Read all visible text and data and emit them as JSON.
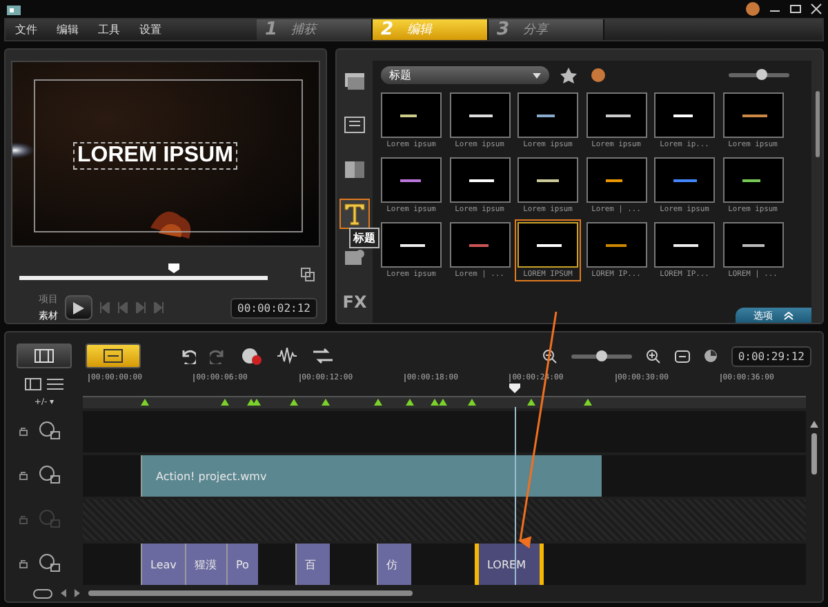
{
  "menu": [
    "文件",
    "编辑",
    "工具",
    "设置"
  ],
  "steps": [
    {
      "number": "1",
      "label": "捕获",
      "selected": false
    },
    {
      "number": "2",
      "label": "编辑",
      "selected": true
    },
    {
      "number": "3",
      "label": "分享",
      "selected": false
    }
  ],
  "preview": {
    "overlay_text": "LOREM IPSUM",
    "scrubber": {
      "level": 0.6
    },
    "modes": [
      {
        "label": "项目",
        "selected": false
      },
      {
        "label": "素材",
        "selected": true
      }
    ],
    "timecode": "00:00:02:12"
  },
  "library": {
    "categories": [
      {
        "kind": "media",
        "selected": false
      },
      {
        "kind": "instant",
        "selected": false
      },
      {
        "kind": "transition",
        "selected": false
      },
      {
        "kind": "title",
        "selected": true,
        "tooltip": "标题"
      },
      {
        "kind": "graphic",
        "selected": false
      },
      {
        "kind": "filter",
        "text": "FX",
        "selected": false
      }
    ],
    "dropdown": "标题",
    "size_slider": {
      "level": 0.55
    },
    "thumbnails": [
      {
        "label": "Lorem ipsum",
        "selected": false
      },
      {
        "label": "Lorem ipsum",
        "selected": false
      },
      {
        "label": "Lorem ipsum",
        "selected": false
      },
      {
        "label": "Lorem ipsum",
        "selected": false
      },
      {
        "label": "Lorem ip...",
        "selected": false
      },
      {
        "label": "Lorem ipsum",
        "selected": false
      },
      {
        "label": "Lorem ipsum",
        "selected": false
      },
      {
        "label": "Lorem ipsum",
        "selected": false
      },
      {
        "label": "Lorem ipsum",
        "selected": false
      },
      {
        "label": "Lorem | ...",
        "selected": false
      },
      {
        "label": "Lorem ipsum",
        "selected": false
      },
      {
        "label": "Lorem ipsum",
        "selected": false
      },
      {
        "label": "Lorem ipsum",
        "selected": false
      },
      {
        "label": "Lorem | ...",
        "selected": false
      },
      {
        "label": "LOREM IPSUM",
        "selected": true
      },
      {
        "label": "LOREM IP...",
        "selected": false
      },
      {
        "label": "LOREM IP...",
        "selected": false
      },
      {
        "label": "LOREM | ...",
        "selected": false
      }
    ],
    "options_button": "选项"
  },
  "timeline": {
    "views": [
      {
        "kind": "storyboard",
        "selected": false
      },
      {
        "kind": "timeline",
        "selected": true
      }
    ],
    "zoom_slider": {
      "level": 0.5
    },
    "duration": "0:00:29:12",
    "ruler": [
      "00:00:00:00",
      "00:00:06:00",
      "00:00:12:00",
      "00:00:18:00",
      "00:00:24:00",
      "00:00:30:00",
      "00:00:36:00"
    ],
    "add_remove": "+/- ▾",
    "tracks": [
      {
        "enabled": true
      },
      {
        "enabled": true,
        "clips": [
          {
            "label": "Action! project.wmv",
            "kind": "video",
            "selected": false
          }
        ]
      },
      {
        "enabled": false
      },
      {
        "enabled": true,
        "clips": [
          {
            "label": "Leav",
            "kind": "title",
            "selected": false
          },
          {
            "label": "猩漠",
            "kind": "title",
            "selected": false
          },
          {
            "label": "Po",
            "kind": "title",
            "selected": false
          },
          {
            "label": "百",
            "kind": "title",
            "selected": false
          },
          {
            "label": "仿",
            "kind": "title",
            "selected": false
          },
          {
            "label": "LOREM",
            "kind": "title",
            "selected": true
          }
        ]
      }
    ]
  }
}
